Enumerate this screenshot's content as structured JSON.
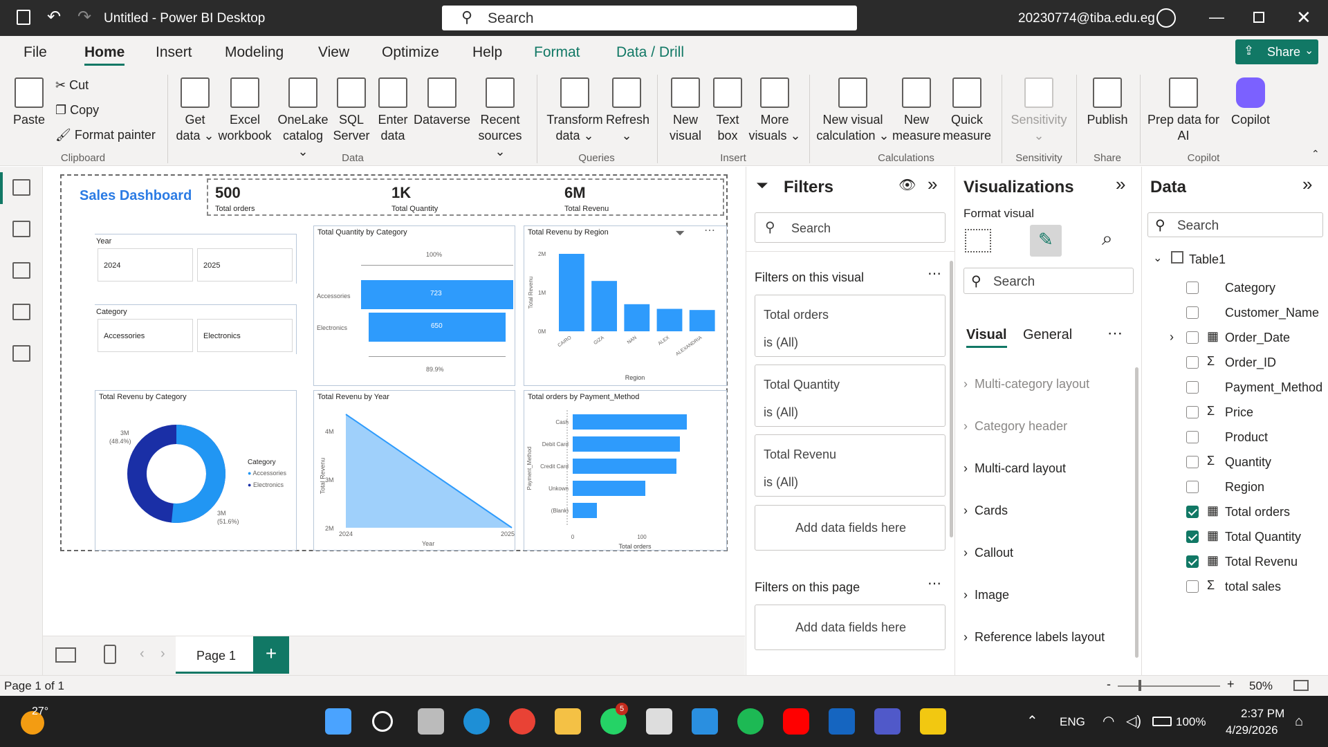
{
  "window": {
    "title": "Untitled - Power BI Desktop",
    "search_placeholder": "Search",
    "user": "20230774@tiba.edu.eg"
  },
  "tabs": [
    "File",
    "Home",
    "Insert",
    "Modeling",
    "View",
    "Optimize",
    "Help",
    "Format",
    "Data / Drill"
  ],
  "share": "Share",
  "ribbon": {
    "paste": "Paste",
    "cut": "Cut",
    "copy": "Copy",
    "format_painter": "Format painter",
    "g_clipboard": "Clipboard",
    "get_data": "Get data ⌄",
    "excel": "Excel workbook",
    "onelake": "OneLake catalog ⌄",
    "sql": "SQL Server",
    "enter": "Enter data",
    "dataverse": "Dataverse",
    "recent": "Recent sources ⌄",
    "g_data": "Data",
    "transform": "Transform data ⌄",
    "refresh": "Refresh ⌄",
    "g_queries": "Queries",
    "new_visual": "New visual",
    "text_box": "Text box",
    "more_visuals": "More visuals ⌄",
    "g_insert": "Insert",
    "new_vis_calc": "New visual calculation ⌄",
    "new_measure": "New measure",
    "quick_measure": "Quick measure",
    "g_calc": "Calculations",
    "sensitivity": "Sensitivity ⌄",
    "g_sensitivity": "Sensitivity",
    "publish": "Publish",
    "g_share": "Share",
    "copilot": "Prep data for AI",
    "copilot2": "Copilot",
    "g_copilot": "Copilot"
  },
  "report": {
    "title": "Sales Dashboard",
    "kpis": [
      {
        "value": "500",
        "label": "Total orders"
      },
      {
        "value": "1K",
        "label": "Total Quantity"
      },
      {
        "value": "6M",
        "label": "Total Revenu"
      }
    ],
    "year_slicer": {
      "label": "Year",
      "items": [
        "2024",
        "2025"
      ]
    },
    "category_slicer": {
      "label": "Category",
      "items": [
        "Accessories",
        "Electronics"
      ]
    },
    "qty_cat": {
      "title": "Total Quantity by Category",
      "top": "100%",
      "bottom": "89.9%",
      "labels": [
        "Accessories",
        "Electronics"
      ],
      "values": [
        "723",
        "650"
      ]
    },
    "rev_region": {
      "title": "Total Revenu by Region",
      "ylabel": "Total Revenu",
      "xlabel": "Region",
      "yticks": [
        "2M",
        "1M",
        "0M"
      ],
      "categories": [
        "CAIRO",
        "GIZA",
        "NAN",
        "ALEX",
        "ALEXANDRIA"
      ]
    },
    "rev_cat": {
      "title": "Total Revenu by Category",
      "legend_title": "Category",
      "legend": [
        "Accessories",
        "Electronics"
      ],
      "l1": "3M",
      "l1p": "(48.4%)",
      "l2": "3M",
      "l2p": "(51.6%)"
    },
    "rev_year": {
      "title": "Total Revenu by Year",
      "ylabel": "Total Revenu",
      "xlabel": "Year",
      "yticks": [
        "4M",
        "3M",
        "2M"
      ],
      "x0": "2024",
      "x1": "2025"
    },
    "orders_pay": {
      "title": "Total orders by Payment_Method",
      "ylabel": "Payment_Method",
      "xlabel": "Total orders",
      "categories": [
        "Cash",
        "Debit Card",
        "Credit Card",
        "Unkown",
        "(Blank)"
      ],
      "x0": "0",
      "x1": "100"
    }
  },
  "chart_data": [
    {
      "type": "bar",
      "title": "Total Quantity by Category",
      "categories": [
        "Accessories",
        "Electronics"
      ],
      "values": [
        723,
        650
      ]
    },
    {
      "type": "bar",
      "title": "Total Revenu by Region",
      "xlabel": "Region",
      "ylabel": "Total Revenu",
      "categories": [
        "CAIRO",
        "GIZA",
        "NAN",
        "ALEX",
        "ALEXANDRIA"
      ],
      "values": [
        2.0,
        1.3,
        0.7,
        0.58,
        0.55
      ],
      "ylim": [
        0,
        2
      ]
    },
    {
      "type": "pie",
      "title": "Total Revenu by Category",
      "categories": [
        "Accessories",
        "Electronics"
      ],
      "values": [
        48.4,
        51.6
      ]
    },
    {
      "type": "area",
      "title": "Total Revenu by Year",
      "xlabel": "Year",
      "ylabel": "Total Revenu",
      "x": [
        "2024",
        "2025"
      ],
      "values": [
        4.3,
        2.0
      ]
    },
    {
      "type": "bar",
      "title": "Total orders by Payment_Method",
      "xlabel": "Total orders",
      "ylabel": "Payment_Method",
      "categories": [
        "Cash",
        "Debit Card",
        "Credit Card",
        "Unkown",
        "(Blank)"
      ],
      "values": [
        165,
        155,
        150,
        105,
        35
      ]
    }
  ],
  "filters": {
    "title": "Filters",
    "search": "Search",
    "on_visual": "Filters on this visual",
    "items": [
      {
        "name": "Total orders",
        "state": "is (All)"
      },
      {
        "name": "Total Quantity",
        "state": "is (All)"
      },
      {
        "name": "Total Revenu",
        "state": "is (All)"
      }
    ],
    "add": "Add data fields here",
    "on_page": "Filters on this page",
    "add2": "Add data fields here"
  },
  "viz": {
    "title": "Visualizations",
    "format_visual": "Format visual",
    "search": "Search",
    "tab_visual": "Visual",
    "tab_general": "General",
    "sections": [
      "Multi-category layout",
      "Category header",
      "Multi-card layout",
      "Cards",
      "Callout",
      "Image",
      "Reference labels layout"
    ]
  },
  "data": {
    "title": "Data",
    "search": "Search",
    "table": "Table1",
    "fields": [
      {
        "name": "Category",
        "sigma": false,
        "calc": false,
        "checked": false
      },
      {
        "name": "Customer_Name",
        "sigma": false,
        "calc": false,
        "checked": false
      },
      {
        "name": "Order_Date",
        "sigma": false,
        "calc": true,
        "checked": false
      },
      {
        "name": "Order_ID",
        "sigma": true,
        "calc": false,
        "checked": false
      },
      {
        "name": "Payment_Method",
        "sigma": false,
        "calc": false,
        "checked": false
      },
      {
        "name": "Price",
        "sigma": true,
        "calc": false,
        "checked": false
      },
      {
        "name": "Product",
        "sigma": false,
        "calc": false,
        "checked": false
      },
      {
        "name": "Quantity",
        "sigma": true,
        "calc": false,
        "checked": false
      },
      {
        "name": "Region",
        "sigma": false,
        "calc": false,
        "checked": false
      },
      {
        "name": "Total orders",
        "sigma": false,
        "calc": true,
        "checked": true
      },
      {
        "name": "Total Quantity",
        "sigma": false,
        "calc": true,
        "checked": true
      },
      {
        "name": "Total Revenu",
        "sigma": false,
        "calc": true,
        "checked": true
      },
      {
        "name": "total sales",
        "sigma": true,
        "calc": false,
        "checked": false
      }
    ]
  },
  "pages": {
    "current": "Page 1",
    "add": "+"
  },
  "status": {
    "page": "Page 1 of 1",
    "zoom": "50%"
  },
  "taskbar": {
    "temp": "27°",
    "lang": "ENG",
    "battery": "100%",
    "time": "2:37 PM",
    "date": "4/29/2026",
    "badge": "5"
  },
  "colors": {
    "accent": "#117865",
    "bar": "#2e9bfc",
    "donut_a": "#2196f3",
    "donut_b": "#1a2fa6"
  }
}
